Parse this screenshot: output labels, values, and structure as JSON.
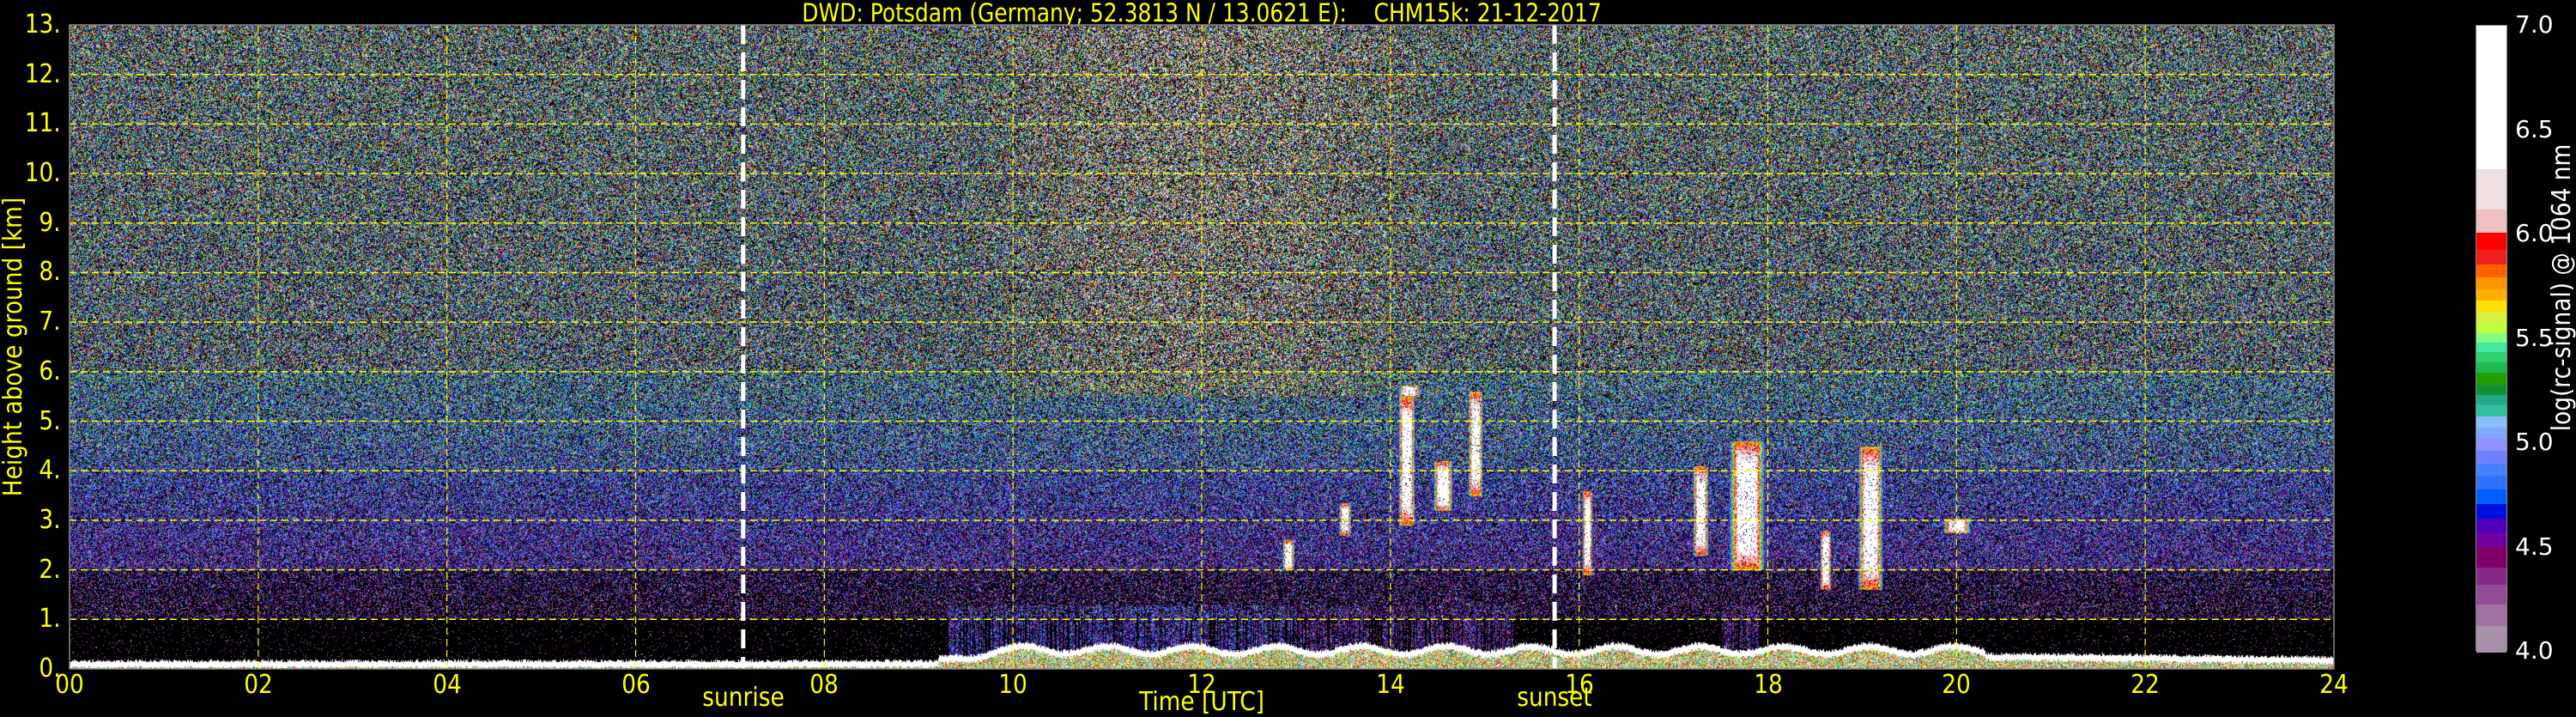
{
  "chart_data": {
    "type": "heatmap",
    "title": "DWD: Potsdam (Germany; 52.3813 N / 13.0621 E):    CHM15k: 21-12-2017",
    "xlabel": "Time [UTC]",
    "ylabel": "Height above ground [km]",
    "xlim": [
      0,
      24
    ],
    "ylim": [
      0,
      13
    ],
    "x_ticks": [
      "00",
      "02",
      "04",
      "06",
      "08",
      "10",
      "12",
      "14",
      "16",
      "18",
      "20",
      "22",
      "24"
    ],
    "x_tick_values": [
      0,
      2,
      4,
      6,
      8,
      10,
      12,
      14,
      16,
      18,
      20,
      22,
      24
    ],
    "y_ticks": [
      "0.",
      "1.",
      "2.",
      "3.",
      "4.",
      "5.",
      "6.",
      "7.",
      "8.",
      "9.",
      "10.",
      "11.",
      "12.",
      "13."
    ],
    "y_tick_values": [
      0,
      1,
      2,
      3,
      4,
      5,
      6,
      7,
      8,
      9,
      10,
      11,
      12,
      13
    ],
    "grid": true,
    "grid_color": "#ffff00",
    "annotations": [
      {
        "label": "sunrise",
        "time": 7.14
      },
      {
        "label": "sunset",
        "time": 15.74
      }
    ],
    "colorbar": {
      "label": "log(rc-signal) @ 1064 nm",
      "range": [
        4.0,
        7.0
      ],
      "ticks": [
        "4.0",
        "4.5",
        "5.0",
        "5.5",
        "6.0",
        "6.5",
        "7.0"
      ],
      "tick_values": [
        4.0,
        4.5,
        5.0,
        5.5,
        6.0,
        6.5,
        7.0
      ],
      "bounds": [
        4.0,
        4.125,
        4.227,
        4.324,
        4.406,
        4.503,
        4.568,
        4.638,
        4.709,
        4.778,
        4.845,
        4.903,
        4.964,
        5.022,
        5.076,
        5.13,
        5.189,
        5.232,
        5.282,
        5.338,
        5.39,
        5.437,
        5.483,
        5.53,
        5.584,
        5.632,
        5.684,
        5.74,
        5.796,
        5.859,
        5.926,
        6.012,
        6.12,
        6.315,
        7.0
      ],
      "colors": [
        "#a890a8",
        "#a070a0",
        "#904c94",
        "#882888",
        "#800068",
        "#7000a0",
        "#5000b8",
        "#0010e0",
        "#0060ff",
        "#3070ff",
        "#4880ff",
        "#7080ff",
        "#9090ff",
        "#80a8ff",
        "#88c0ff",
        "#30c0a0",
        "#20a888",
        "#109030",
        "#20a000",
        "#20b850",
        "#30d070",
        "#40e8a0",
        "#80ff80",
        "#c0ff40",
        "#d8f040",
        "#ffe000",
        "#ffb000",
        "#ff9800",
        "#ff6000",
        "#f02020",
        "#ff0000",
        "#f0c0c0",
        "#ece0e0",
        "#ffffff"
      ]
    },
    "cloud_features": [
      {
        "t": [
          14.08,
          14.32
        ],
        "h": [
          5.5,
          5.72
        ]
      },
      {
        "t": [
          14.08,
          14.26
        ],
        "h": [
          2.9,
          5.5
        ]
      },
      {
        "t": [
          14.45,
          14.66
        ],
        "h": [
          3.2,
          4.2
        ]
      },
      {
        "t": [
          14.82,
          14.98
        ],
        "h": [
          3.5,
          5.6
        ]
      },
      {
        "t": [
          13.45,
          13.58
        ],
        "h": [
          2.7,
          3.35
        ]
      },
      {
        "t": [
          12.85,
          12.98
        ],
        "h": [
          2.0,
          2.6
        ]
      },
      {
        "t": [
          16.03,
          16.14
        ],
        "h": [
          1.9,
          3.6
        ]
      },
      {
        "t": [
          17.2,
          17.37
        ],
        "h": [
          2.3,
          4.1
        ]
      },
      {
        "t": [
          17.58,
          17.97
        ],
        "h": [
          2.0,
          4.6
        ]
      },
      {
        "t": [
          18.55,
          18.67
        ],
        "h": [
          1.6,
          2.8
        ]
      },
      {
        "t": [
          18.95,
          19.22
        ],
        "h": [
          1.6,
          4.5
        ]
      },
      {
        "t": [
          19.85,
          20.15
        ],
        "h": [
          2.75,
          3.05
        ]
      }
    ]
  }
}
